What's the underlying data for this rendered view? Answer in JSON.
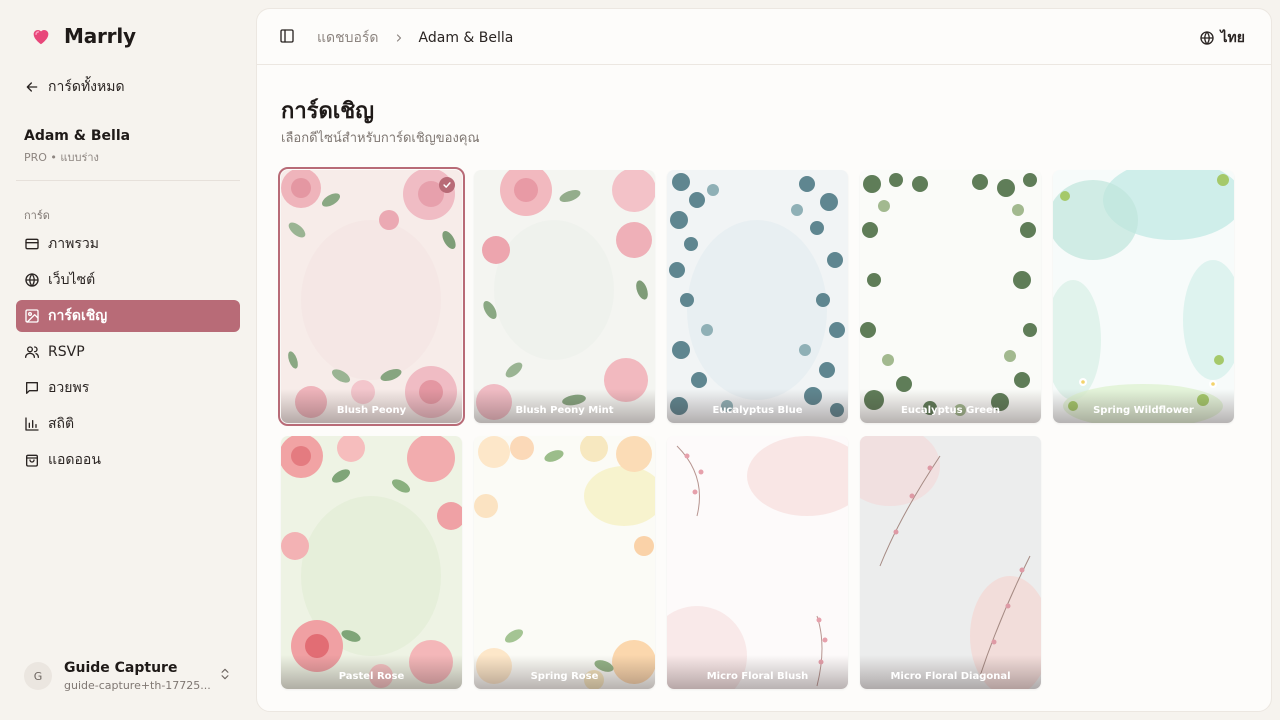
{
  "app": {
    "name": "Marrly",
    "brand_color": "#e8477a"
  },
  "sidebar": {
    "back_label": "การ์ดทั้งหมด",
    "project": {
      "name": "Adam & Bella",
      "meta": "PRO • แบบร่าง"
    },
    "section_label": "การ์ด",
    "items": [
      {
        "label": "ภาพรวม",
        "icon": "card-icon"
      },
      {
        "label": "เว็บไซต์",
        "icon": "globe-icon"
      },
      {
        "label": "การ์ดเชิญ",
        "icon": "image-icon",
        "active": true
      },
      {
        "label": "RSVP",
        "icon": "users-icon"
      },
      {
        "label": "อวยพร",
        "icon": "message-icon"
      },
      {
        "label": "สถิติ",
        "icon": "chart-icon"
      },
      {
        "label": "แอดออน",
        "icon": "bag-icon"
      }
    ],
    "user": {
      "initial": "G",
      "name": "Guide Capture",
      "email": "guide-capture+th-17725..."
    }
  },
  "header": {
    "breadcrumb": {
      "parent": "แดชบอร์ด",
      "current": "Adam & Bella"
    },
    "language": "ไทย"
  },
  "main": {
    "title": "การ์ดเชิญ",
    "subtitle": "เลือกดีไซน์สำหรับการ์ดเชิญของคุณ",
    "accent_color": "#b86b77",
    "templates": [
      {
        "name": "Blush Peony",
        "selected": true
      },
      {
        "name": "Blush Peony Mint"
      },
      {
        "name": "Eucalyptus Blue"
      },
      {
        "name": "Eucalyptus Green"
      },
      {
        "name": "Spring Wildflower"
      },
      {
        "name": "Pastel Rose"
      },
      {
        "name": "Spring Rose"
      },
      {
        "name": "Micro Floral Blush"
      },
      {
        "name": "Micro Floral Diagonal"
      }
    ]
  }
}
